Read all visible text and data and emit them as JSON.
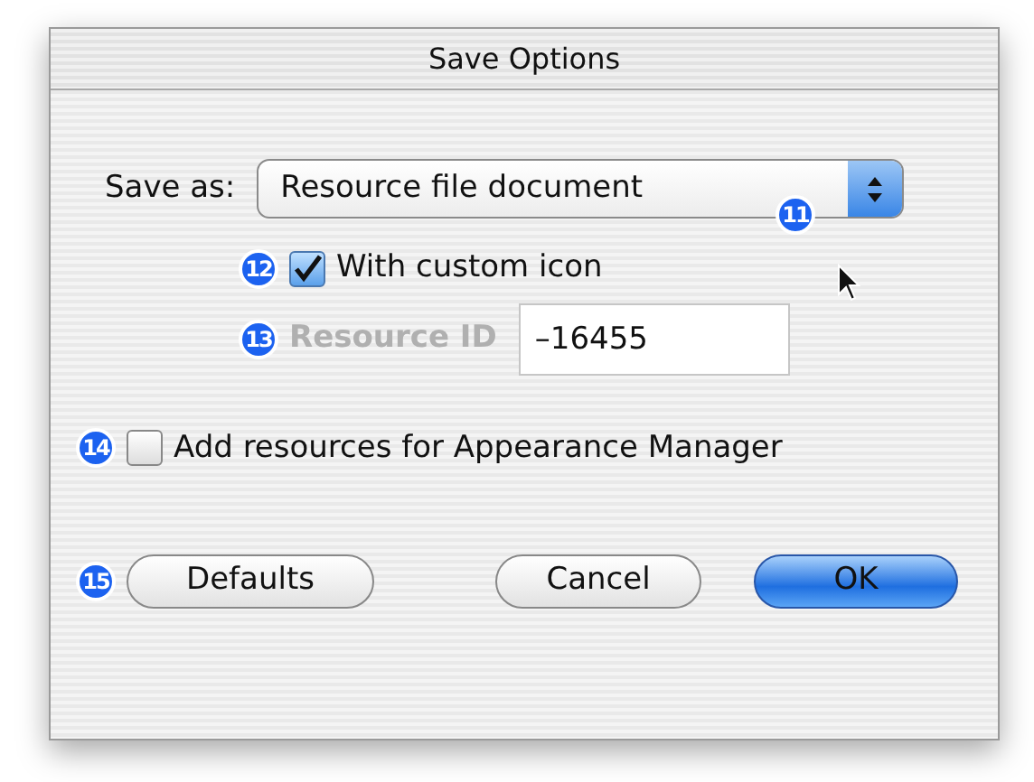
{
  "window": {
    "title": "Save Options"
  },
  "save_as": {
    "label": "Save as:",
    "value": "Resource file document",
    "callout": "11",
    "options": [
      {
        "kind": "checkbox",
        "label": "With custom icon",
        "checked": true,
        "callout": "12"
      },
      {
        "kind": "field",
        "label": "Resource ID",
        "value": "–16455",
        "disabled": true,
        "callout": "13"
      }
    ]
  },
  "options": [
    {
      "kind": "checkbox",
      "label": "Add resources for Appearance Manager",
      "checked": false,
      "callout": "14"
    }
  ],
  "buttons_callout": "15",
  "buttons": [
    {
      "label": "Defaults",
      "default": false
    },
    {
      "label": "Cancel",
      "default": false
    },
    {
      "label": "OK",
      "default": true
    }
  ]
}
